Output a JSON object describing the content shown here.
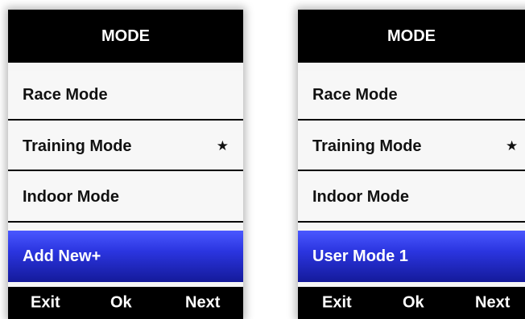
{
  "screens": [
    {
      "header": {
        "title": "MODE"
      },
      "items": [
        {
          "label": "Race Mode",
          "starred": false
        },
        {
          "label": "Training Mode",
          "starred": true,
          "star": "★"
        },
        {
          "label": "Indoor Mode",
          "starred": false
        }
      ],
      "selected": {
        "label": "Add New",
        "suffix": "+"
      },
      "footer": {
        "exit": "Exit",
        "ok": "Ok",
        "next": "Next"
      }
    },
    {
      "header": {
        "title": "MODE"
      },
      "items": [
        {
          "label": "Race Mode",
          "starred": false
        },
        {
          "label": "Training Mode",
          "starred": true,
          "star": "★"
        },
        {
          "label": "Indoor Mode",
          "starred": false
        }
      ],
      "selected": {
        "label": "User Mode 1"
      },
      "footer": {
        "exit": "Exit",
        "ok": "Ok",
        "next": "Next"
      }
    }
  ],
  "colors": {
    "header_bg": "#000000",
    "selected_bg": "#2b35e0",
    "row_bg": "#f7f7f7",
    "footer_bg": "#000000"
  }
}
